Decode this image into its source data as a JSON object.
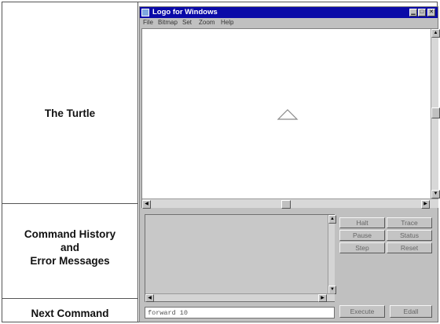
{
  "captions": {
    "turtle": "The Turtle",
    "history_line1": "Command History",
    "history_line2": "and",
    "history_line3": "Error Messages",
    "next": "Next Command"
  },
  "window": {
    "title": "Logo for Windows",
    "menu": [
      "File",
      "Bitmap",
      "Set",
      "Zoom",
      "Help"
    ]
  },
  "command_input": {
    "value": "forward 10"
  },
  "buttons": {
    "halt": "Halt",
    "trace": "Trace",
    "pause": "Pause",
    "status": "Status",
    "step": "Step",
    "reset": "Reset",
    "execute": "Execute",
    "edall": "Edall"
  },
  "colors": {
    "titlebar": "#0a0aa8",
    "window_bg": "#c0c0c0",
    "canvas_bg": "#ffffff"
  }
}
